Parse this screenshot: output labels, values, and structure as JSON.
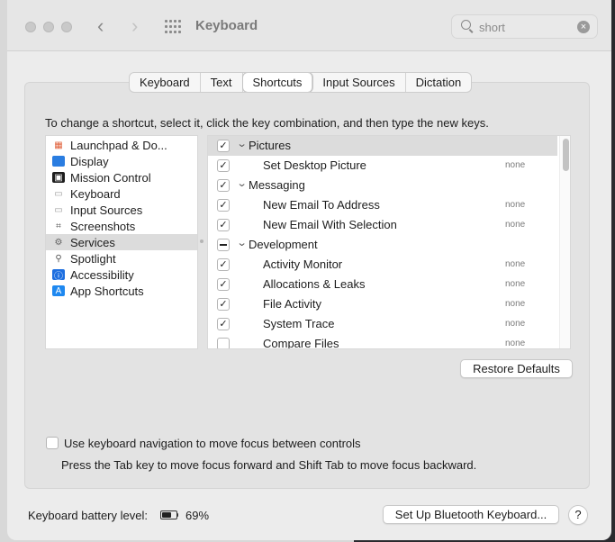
{
  "window": {
    "title": "Keyboard",
    "back_icon": "‹",
    "forward_icon": "›"
  },
  "search": {
    "value": "short",
    "clear_icon": "×"
  },
  "tabs": [
    {
      "label": "Keyboard"
    },
    {
      "label": "Text"
    },
    {
      "label": "Shortcuts"
    },
    {
      "label": "Input Sources"
    },
    {
      "label": "Dictation"
    }
  ],
  "selected_tab": "Shortcuts",
  "instruction": "To change a shortcut, select it, click the key combination, and then type the new keys.",
  "categories": [
    {
      "label": "Launchpad & Do...",
      "icon": "launchpad-icon"
    },
    {
      "label": "Display",
      "icon": "display-icon"
    },
    {
      "label": "Mission Control",
      "icon": "mission-control-icon"
    },
    {
      "label": "Keyboard",
      "icon": "keyboard-icon"
    },
    {
      "label": "Input Sources",
      "icon": "input-sources-icon"
    },
    {
      "label": "Screenshots",
      "icon": "screenshots-icon"
    },
    {
      "label": "Services",
      "icon": "gear-icon"
    },
    {
      "label": "Spotlight",
      "icon": "magnifier-icon"
    },
    {
      "label": "Accessibility",
      "icon": "accessibility-icon"
    },
    {
      "label": "App Shortcuts",
      "icon": "app-store-icon"
    }
  ],
  "selected_category": "Services",
  "shortcuts": [
    {
      "label": "Pictures",
      "group": true,
      "state": "checked",
      "key": ""
    },
    {
      "label": "Set Desktop Picture",
      "group": false,
      "state": "checked",
      "key": "none"
    },
    {
      "label": "Messaging",
      "group": true,
      "state": "checked",
      "key": ""
    },
    {
      "label": "New Email To Address",
      "group": false,
      "state": "checked",
      "key": "none"
    },
    {
      "label": "New Email With Selection",
      "group": false,
      "state": "checked",
      "key": "none"
    },
    {
      "label": "Development",
      "group": true,
      "state": "mixed",
      "key": ""
    },
    {
      "label": "Activity Monitor",
      "group": false,
      "state": "checked",
      "key": "none"
    },
    {
      "label": "Allocations & Leaks",
      "group": false,
      "state": "checked",
      "key": "none"
    },
    {
      "label": "File Activity",
      "group": false,
      "state": "checked",
      "key": "none"
    },
    {
      "label": "System Trace",
      "group": false,
      "state": "checked",
      "key": "none"
    },
    {
      "label": "Compare Files",
      "group": false,
      "state": "unchecked",
      "key": "none"
    }
  ],
  "buttons": {
    "restore_defaults": "Restore Defaults",
    "bluetooth_keyboard": "Set Up Bluetooth Keyboard...",
    "help": "?"
  },
  "keyboard_navigation": {
    "checked": false,
    "label": "Use keyboard navigation to move focus between controls",
    "hint": "Press the Tab key to move focus forward and Shift Tab to move focus backward."
  },
  "battery": {
    "label": "Keyboard battery level:",
    "percent_text": "69%",
    "level": 0.69
  }
}
